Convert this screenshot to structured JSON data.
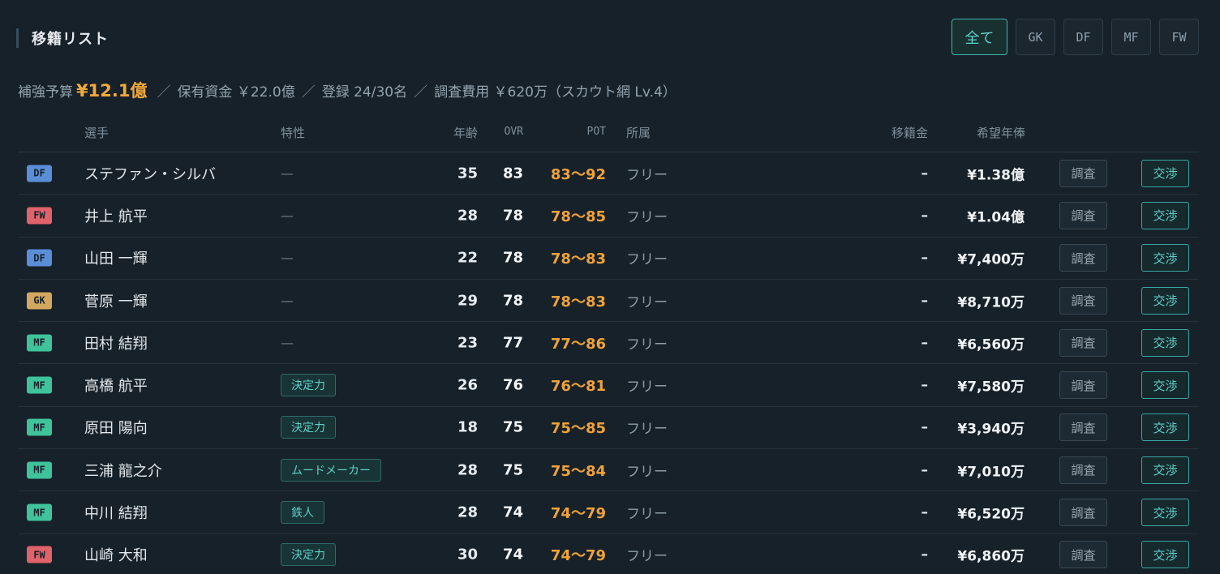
{
  "header": {
    "title": "移籍リスト"
  },
  "filters": [
    {
      "label": "全て",
      "active": true
    },
    {
      "label": "GK",
      "active": false
    },
    {
      "label": "DF",
      "active": false
    },
    {
      "label": "MF",
      "active": false
    },
    {
      "label": "FW",
      "active": false
    }
  ],
  "summary": {
    "budget_label": "補強予算",
    "budget_value": "¥12.1億",
    "sep": "／",
    "funds": "保有資金 ￥22.0億",
    "registered": "登録 24/30名",
    "scout": "調査費用 ￥620万（スカウト網 Lv.4）"
  },
  "columns": {
    "player": "選手",
    "trait": "特性",
    "age": "年齢",
    "ovr": "OVR",
    "pot": "POT",
    "club": "所属",
    "fee": "移籍金",
    "salary": "希望年俸"
  },
  "position_colors": {
    "DF": "#5b8ed8",
    "FW": "#e0626b",
    "GK": "#d2a85f",
    "MF": "#3fc39a"
  },
  "actions": {
    "investigate": "調査",
    "negotiate": "交渉"
  },
  "players": [
    {
      "pos": "DF",
      "name": "ステファン・シルバ",
      "trait": "—",
      "age": "35",
      "ovr": "83",
      "pot": "83〜92",
      "club": "フリー",
      "fee": "–",
      "salary": "¥1.38億"
    },
    {
      "pos": "FW",
      "name": "井上 航平",
      "trait": "—",
      "age": "28",
      "ovr": "78",
      "pot": "78〜85",
      "club": "フリー",
      "fee": "–",
      "salary": "¥1.04億"
    },
    {
      "pos": "DF",
      "name": "山田 一輝",
      "trait": "—",
      "age": "22",
      "ovr": "78",
      "pot": "78〜83",
      "club": "フリー",
      "fee": "–",
      "salary": "¥7,400万"
    },
    {
      "pos": "GK",
      "name": "菅原 一輝",
      "trait": "—",
      "age": "29",
      "ovr": "78",
      "pot": "78〜83",
      "club": "フリー",
      "fee": "–",
      "salary": "¥8,710万"
    },
    {
      "pos": "MF",
      "name": "田村 結翔",
      "trait": "—",
      "age": "23",
      "ovr": "77",
      "pot": "77〜86",
      "club": "フリー",
      "fee": "–",
      "salary": "¥6,560万"
    },
    {
      "pos": "MF",
      "name": "高橋 航平",
      "trait": "決定力",
      "age": "26",
      "ovr": "76",
      "pot": "76〜81",
      "club": "フリー",
      "fee": "–",
      "salary": "¥7,580万"
    },
    {
      "pos": "MF",
      "name": "原田 陽向",
      "trait": "決定力",
      "age": "18",
      "ovr": "75",
      "pot": "75〜85",
      "club": "フリー",
      "fee": "–",
      "salary": "¥3,940万"
    },
    {
      "pos": "MF",
      "name": "三浦 龍之介",
      "trait": "ムードメーカー",
      "age": "28",
      "ovr": "75",
      "pot": "75〜84",
      "club": "フリー",
      "fee": "–",
      "salary": "¥7,010万"
    },
    {
      "pos": "MF",
      "name": "中川 結翔",
      "trait": "鉄人",
      "age": "28",
      "ovr": "74",
      "pot": "74〜79",
      "club": "フリー",
      "fee": "–",
      "salary": "¥6,520万"
    },
    {
      "pos": "FW",
      "name": "山崎 大和",
      "trait": "決定力",
      "age": "30",
      "ovr": "74",
      "pot": "74〜79",
      "club": "フリー",
      "fee": "–",
      "salary": "¥6,860万"
    }
  ]
}
